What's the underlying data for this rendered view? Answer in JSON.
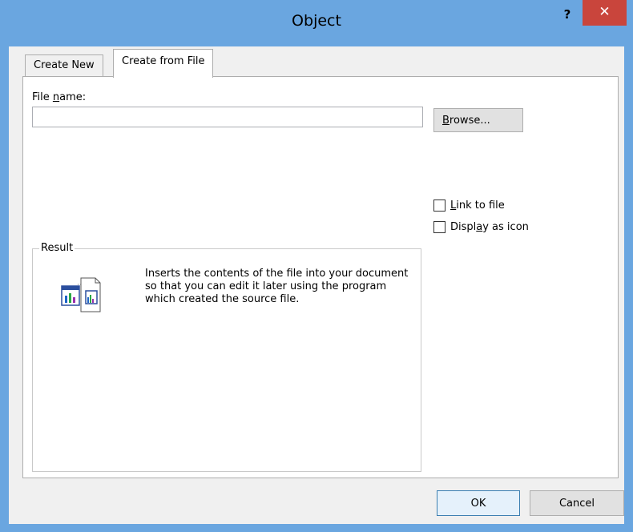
{
  "window": {
    "title": "Object",
    "help_label": "?",
    "close_label": "✕"
  },
  "tabs": [
    {
      "label": "Create New",
      "selected": false
    },
    {
      "label": "Create from File",
      "selected": true
    }
  ],
  "file": {
    "label_pre": "File ",
    "label_accel": "n",
    "label_post": "ame:",
    "value": "",
    "browse_accel": "B",
    "browse_post": "rowse..."
  },
  "options": {
    "link": {
      "accel": "L",
      "post": "ink to file",
      "checked": false
    },
    "display_icon": {
      "pre": "Displ",
      "accel": "a",
      "post": "y as icon",
      "checked": false
    }
  },
  "result": {
    "legend": "Result",
    "text": "Inserts the contents of the file into your document so that you can edit it later using the program which created the source file."
  },
  "buttons": {
    "ok": "OK",
    "cancel": "Cancel"
  }
}
